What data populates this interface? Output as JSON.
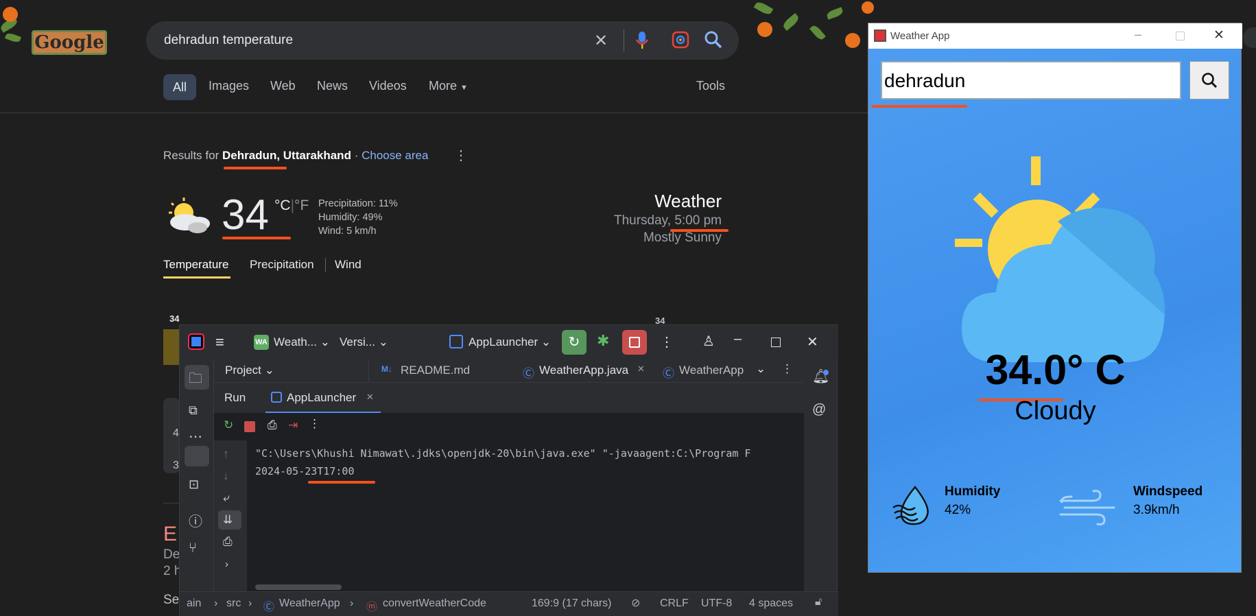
{
  "google": {
    "logo_text": "Google",
    "search_query": "dehradun temperature",
    "tabs": [
      "All",
      "Images",
      "Web",
      "News",
      "Videos",
      "More"
    ],
    "tools_label": "Tools",
    "results_for_prefix": "Results for",
    "location": "Dehradun, Uttarakhand",
    "separator": "·",
    "choose_area": "Choose area",
    "temperature": "34",
    "unit_c": "°C",
    "unit_sep": "|",
    "unit_f": "°F",
    "precipitation": "Precipitation: 11%",
    "humidity": "Humidity: 49%",
    "wind": "Wind: 5 km/h",
    "weather_title": "Weather",
    "day_time": "Thursday, 5:00 pm",
    "condition": "Mostly Sunny",
    "weather_tabs": [
      "Temperature",
      "Precipitation",
      "Wind"
    ],
    "chart_label_left": "34",
    "chart_label_right": "34",
    "partial_snippets": {
      "ex": "E",
      "de": "De",
      "h": "2 h",
      "se": "Se",
      "num1": "4",
      "num2": "3"
    }
  },
  "ide": {
    "project_badge": "WA",
    "project_name": "Weath...",
    "vcs": "Versi...",
    "run_config": "AppLauncher",
    "project_label": "Project",
    "editor_tabs": [
      "README.md",
      "WeatherApp.java",
      "WeatherApp"
    ],
    "run_label": "Run",
    "run_tab": "AppLauncher",
    "console_lines": [
      "\"C:\\Users\\Khushi Nimawat\\.jdks\\openjdk-20\\bin\\java.exe\" \"-javaagent:C:\\Program F",
      "2024-05-23T17:00"
    ],
    "status": {
      "path": [
        "ain",
        "src",
        "WeatherApp",
        "convertWeatherCode"
      ],
      "position": "169:9 (17 chars)",
      "line_sep": "CRLF",
      "encoding": "UTF-8",
      "indent": "4 spaces"
    }
  },
  "weather_app": {
    "window_title": "Weather App",
    "search_value": "dehradun",
    "temperature": "34.0° C",
    "condition": "Cloudy",
    "humidity_label": "Humidity",
    "humidity_value": "42%",
    "windspeed_label": "Windspeed",
    "windspeed_value": "3.9km/h"
  },
  "colors": {
    "accent_underline": "#f4511e",
    "google_bg": "#1f1f1f",
    "app_blue": "#4f9ef3",
    "sun": "#fbd648",
    "cloud": "#5ab9f5"
  }
}
